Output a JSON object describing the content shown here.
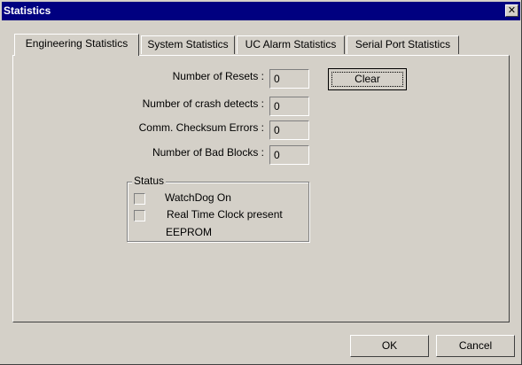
{
  "window": {
    "title": "Statistics",
    "close_glyph": "✕"
  },
  "tabs": [
    {
      "label": "Engineering Statistics",
      "active": true
    },
    {
      "label": "System Statistics",
      "active": false
    },
    {
      "label": "UC Alarm Statistics",
      "active": false
    },
    {
      "label": "Serial Port Statistics",
      "active": false
    }
  ],
  "fields": {
    "resets": {
      "label": "Number of Resets :",
      "value": "0"
    },
    "crash_detects": {
      "label": "Number of crash detects :",
      "value": "0"
    },
    "checksum_errors": {
      "label": "Comm. Checksum Errors :",
      "value": "0"
    },
    "bad_blocks": {
      "label": "Number of Bad Blocks :",
      "value": "0"
    }
  },
  "clear_button": "Clear",
  "status": {
    "title": "Status",
    "items": [
      {
        "label": "WatchDog On",
        "checked": false
      },
      {
        "label": "Real Time Clock present",
        "checked": false
      },
      {
        "label": "EEPROM"
      }
    ]
  },
  "footer": {
    "ok_label": "OK",
    "cancel_label": "Cancel"
  }
}
